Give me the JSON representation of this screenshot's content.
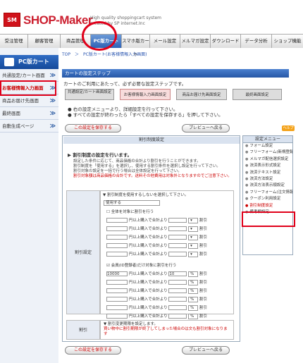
{
  "header": {
    "logo_mark": "SM",
    "logo": "SHOP-Maker",
    "tagline1": "High quality shoppingcart system",
    "tagline2": "created by SP internet.Inc"
  },
  "topnav": [
    "受注管理",
    "顧客管理",
    "商品管理",
    "PC版カート",
    "スマホ版カート",
    "メール設定",
    "メルマガ設定",
    "ダウンロード",
    "データ分析",
    "ショップ機能"
  ],
  "sidebar": {
    "title": "PC版カート",
    "items": [
      "共通設定/カート画面",
      "お客様情報入力画面",
      "商品お届け先画面",
      "最終画面",
      "自動生成ページ"
    ]
  },
  "breadcrumb": "TOP　＞　PC版カート(お客様情報入力画面)",
  "panel_title": "カートの設定ステップ",
  "intro": "カートのご利用にあたって、必ず必要な設定ステップです。",
  "steps": [
    "共通設定/カート画面設定",
    "お客様情報入力画面設定",
    "商品お届け先画面設定",
    "最終画面設定"
  ],
  "notes": [
    "右の設定メニューより、詳細設定を行って下さい。",
    "すべての設定が終わったら「すべての設定を保存する」を押して下さい。"
  ],
  "help": "ヘルプ",
  "save_btn": "この設定を保存する",
  "preview_btn": "プレビューへ戻る",
  "form_title": "割引制度設定",
  "section_title": "割引制度の設定を行います。",
  "desc": [
    "設定した条件に応じて、商品価格の合計より割引を行うことができます。",
    "割引制度を「使用する」を選択し、使用する割引条件を選択し設定を行って下さい。",
    "割引対象の設定を一括で行う場合は全体設定を行って下さい。"
  ],
  "warn": "割引対象額は商品価格の合計です。送料その他費用は対象外となりますのでご注意下さい。",
  "table_label": "割引設定",
  "sub_note": "割引制度を使用するしないを選択して下さい。",
  "use_select": "使用する",
  "all_check": "全体を対象に割引を行う",
  "row_text": "円以上購入で合計より",
  "member_check": "会員(ID登録者)だけ対象に割引を行う",
  "member_rows": [
    {
      "amount": "10000",
      "rate": "10",
      "unit": "%"
    },
    {
      "amount": "",
      "rate": "",
      "unit": "%"
    },
    {
      "amount": "",
      "rate": "",
      "unit": "%"
    },
    {
      "amount": "",
      "rate": "",
      "unit": "%"
    },
    {
      "amount": "",
      "rate": "",
      "unit": "%"
    },
    {
      "amount": "",
      "rate": "",
      "unit": "%"
    }
  ],
  "discount_word": "割引",
  "lower_label": "割引",
  "lower_note1": "割引変更期限を設定します。",
  "lower_note2": "買い物中に割引期限が終了してしまった場合のは文も割引対象になります",
  "menu_title": "設定メニュー",
  "menu": [
    "フォーム設定",
    "フリーフォーム(新規登録)",
    "メルマガ配信選択設定",
    "決済表示形式設定",
    "決済テキスト設定",
    "決済方法設定",
    "決済方法表示順設定",
    "フリーフォーム(注文情報)",
    "クーポン利用設定",
    "割引制度設定",
    "備考欄設定"
  ]
}
